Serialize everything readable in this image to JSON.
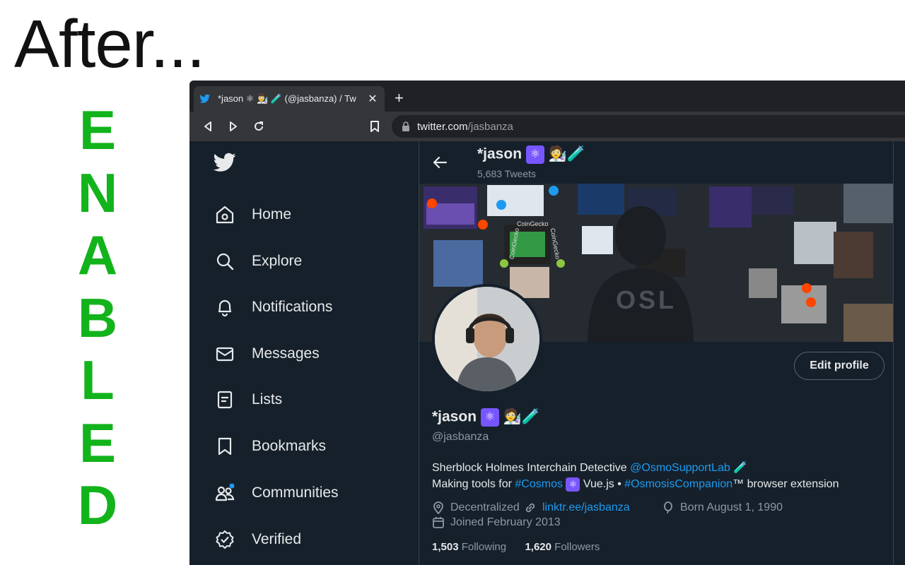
{
  "heading": "After...",
  "side_letters": [
    "E",
    "N",
    "A",
    "B",
    "L",
    "E",
    "D"
  ],
  "browser": {
    "tab_title": "*jason ⚛ 👨‍🔬 🧪 (@jasbanza) / Tw",
    "tab_close": "✕",
    "new_tab": "+",
    "url_host": "twitter.com",
    "url_path": "/jasbanza"
  },
  "sidebar": {
    "items": [
      {
        "label": "Home",
        "icon": "home-icon"
      },
      {
        "label": "Explore",
        "icon": "search-icon"
      },
      {
        "label": "Notifications",
        "icon": "bell-icon"
      },
      {
        "label": "Messages",
        "icon": "mail-icon"
      },
      {
        "label": "Lists",
        "icon": "list-icon"
      },
      {
        "label": "Bookmarks",
        "icon": "bookmark-icon"
      },
      {
        "label": "Communities",
        "icon": "communities-icon"
      },
      {
        "label": "Verified",
        "icon": "verified-icon"
      }
    ]
  },
  "header": {
    "name": "*jason",
    "emoji": "🧑‍🔬🧪",
    "tweets": "5,683 Tweets"
  },
  "banner": {
    "label_osl": "OSL",
    "label_coingecko": "CoinGecko"
  },
  "profile": {
    "edit_button": "Edit profile",
    "name": "*jason",
    "emoji": "🧑‍🔬🧪",
    "handle": "@jasbanza",
    "bio_line1_pre": "Sherblock Holmes Interchain Detective ",
    "bio_line1_link": "@OsmoSupportLab",
    "bio_line1_post": " 🧪",
    "bio_line2_pre": "Making tools for ",
    "bio_line2_link1": "#Cosmos",
    "bio_line2_mid": " Vue.js • ",
    "bio_line2_link2": "#OsmosisCompanion",
    "bio_line2_post": "™ browser extension",
    "location": "Decentralized",
    "website": "linktr.ee/jasbanza",
    "birthday": "Born August 1, 1990",
    "joined": "Joined February 2013",
    "following_count": "1,503",
    "following_label": "Following",
    "followers_count": "1,620",
    "followers_label": "Followers"
  },
  "colors": {
    "enabled_green": "#12b31b",
    "twitter_blue": "#1d9bf0",
    "background": "#15202b",
    "atom_purple": "#7856ff"
  }
}
